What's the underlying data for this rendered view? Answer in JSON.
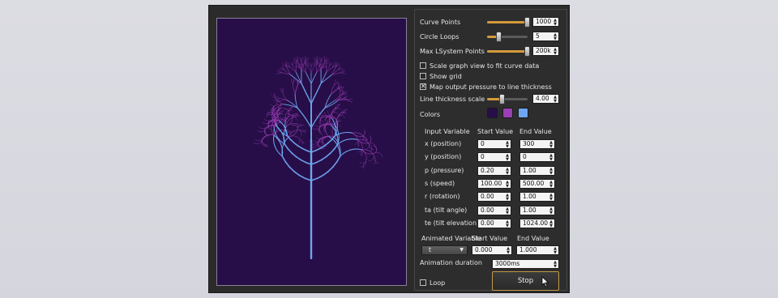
{
  "controls": {
    "curve_points": {
      "label": "Curve Points",
      "value": "1000",
      "level": 0.98
    },
    "circle_loops": {
      "label": "Circle Loops",
      "value": "5",
      "level": 0.28
    },
    "max_lsystem_points": {
      "label": "Max LSystem Points",
      "value": "200k",
      "level": 0.98
    },
    "scale_graph": {
      "label": "Scale graph view to fit curve data",
      "checked": false
    },
    "show_grid": {
      "label": "Show grid",
      "checked": false
    },
    "map_pressure": {
      "label": "Map output pressure to line thickness",
      "checked": true
    },
    "line_thickness": {
      "label": "Line thickness scale",
      "value": "4.00",
      "level": 0.35
    },
    "colors_label": "Colors",
    "colors": [
      "#270e48",
      "#9b3fb5",
      "#6fa6f0"
    ]
  },
  "variables": {
    "headers": {
      "input": "Input Variable",
      "start": "Start Value",
      "end": "End Value"
    },
    "rows": [
      {
        "name": "x (position)",
        "start": "0",
        "end": "300"
      },
      {
        "name": "y (position)",
        "start": "0",
        "end": "0"
      },
      {
        "name": "p (pressure)",
        "start": "0.20",
        "end": "1.00"
      },
      {
        "name": "s (speed)",
        "start": "100.00",
        "end": "500.00"
      },
      {
        "name": "r (rotation)",
        "start": "0.00",
        "end": "1.00"
      },
      {
        "name": "ta (tilt angle)",
        "start": "0.00",
        "end": "1.00"
      },
      {
        "name": "te (tilt elevation)",
        "start": "0.00",
        "end": "1024.00"
      }
    ]
  },
  "animation": {
    "headers": {
      "variable": "Animated Variable",
      "start": "Start Value",
      "end": "End Value"
    },
    "variable": "t",
    "start": "0.000",
    "end": "1.000",
    "duration_label": "Animation duration",
    "duration": "3000ms",
    "loop_label": "Loop",
    "loop_checked": false,
    "stop_label": "Stop"
  }
}
